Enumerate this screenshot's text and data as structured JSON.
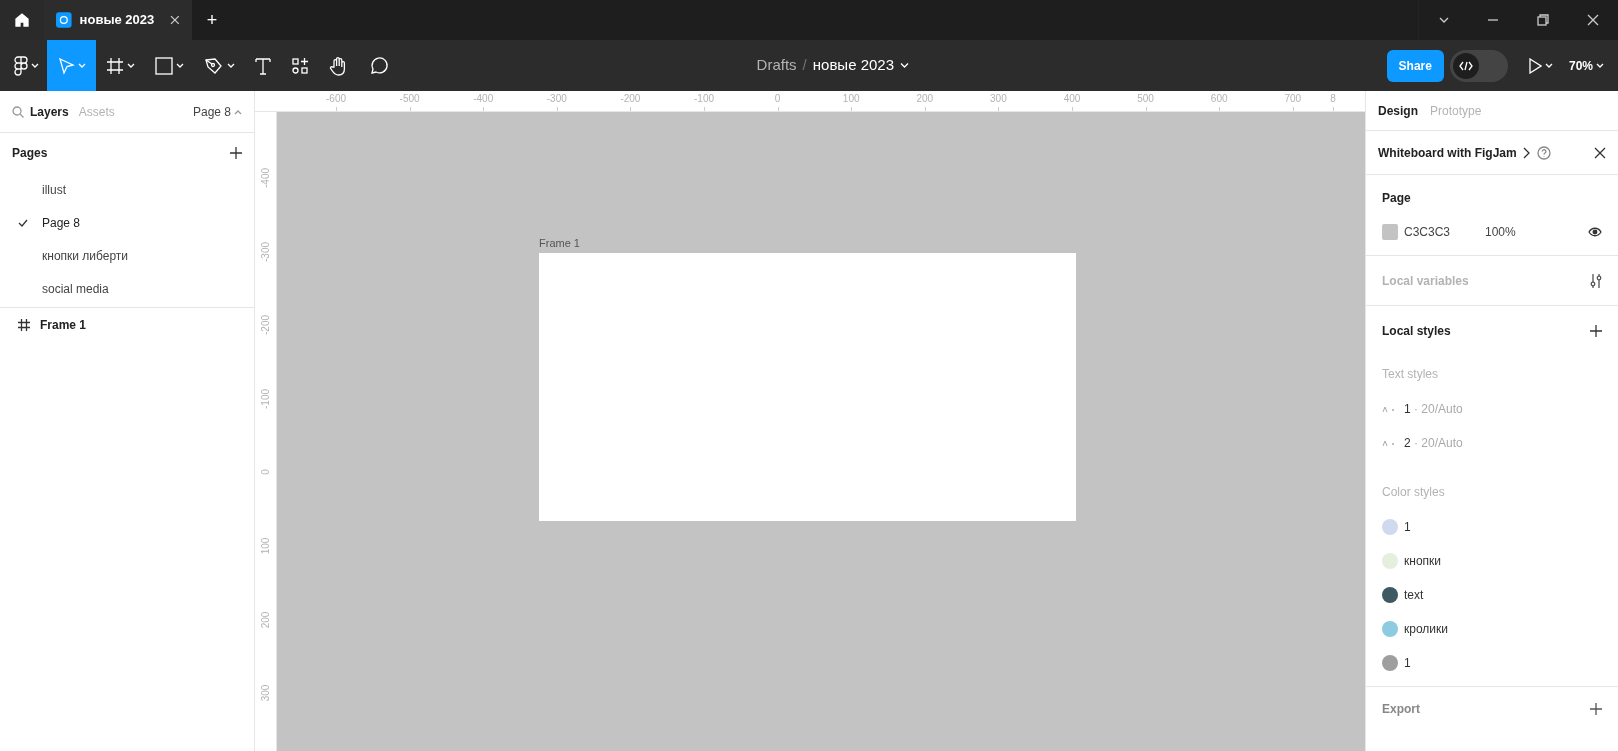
{
  "window_tabs": [
    {
      "kind": "home"
    },
    {
      "kind": "file",
      "title": "новые 2023",
      "selected": true
    },
    {
      "kind": "add",
      "label": "+"
    }
  ],
  "toolbar": {
    "tools": [
      {
        "kind": "main-menu",
        "selected": false,
        "caret": true
      },
      {
        "kind": "move",
        "selected": true,
        "caret": true
      },
      {
        "kind": "frame",
        "selected": false,
        "caret": true
      },
      {
        "kind": "rectangle",
        "selected": false,
        "caret": true
      },
      {
        "kind": "pen",
        "selected": false,
        "caret": true
      },
      {
        "kind": "text",
        "selected": false,
        "caret": false
      },
      {
        "kind": "resources",
        "selected": false,
        "caret": false
      },
      {
        "kind": "hand",
        "selected": false,
        "caret": false
      },
      {
        "kind": "comment",
        "selected": false,
        "caret": false
      }
    ],
    "breadcrumb": {
      "folder": "Drafts",
      "separator": "/",
      "file": "новые 2023"
    },
    "share": "Share",
    "dev_mode": {
      "on": false
    },
    "zoom": "70%"
  },
  "left_panel": {
    "tabs": [
      {
        "label": "Layers",
        "selected": true
      },
      {
        "label": "Assets",
        "selected": false
      }
    ],
    "page_selector": "Page 8",
    "pages_title": "Pages",
    "pages": [
      {
        "name": "illust",
        "selected": false
      },
      {
        "name": "Page 8",
        "selected": true
      },
      {
        "name": "кнопки либерти",
        "selected": false
      },
      {
        "name": "social media",
        "selected": false
      }
    ],
    "layers": [
      {
        "name": "Frame 1"
      }
    ]
  },
  "rulers": {
    "horizontal": [
      "-600",
      "-500",
      "-400",
      "-300",
      "-200",
      "-100",
      "0",
      "100",
      "200",
      "300",
      "400",
      "500",
      "600",
      "700",
      "8"
    ],
    "vertical": [
      "-400",
      "-300",
      "-200",
      "-100",
      "0",
      "100",
      "200",
      "300"
    ]
  },
  "canvas": {
    "frame": {
      "label": "Frame 1"
    }
  },
  "right_panel": {
    "tabs": [
      {
        "label": "Design",
        "selected": true
      },
      {
        "label": "Prototype",
        "selected": false
      }
    ],
    "banner": "Whiteboard with FigJam",
    "page": {
      "title": "Page",
      "color": "#c3c3c3",
      "hex": "C3C3C3",
      "opacity": "100%"
    },
    "local_variables": "Local variables",
    "local_styles": "Local styles",
    "text_styles_title": "Text styles",
    "text_styles": [
      {
        "name": "1",
        "detail": "· 20/Auto"
      },
      {
        "name": "2",
        "detail": "· 20/Auto"
      }
    ],
    "color_styles_title": "Color styles",
    "color_styles": [
      {
        "name": "1",
        "color": "#cfdaee"
      },
      {
        "name": "кнопки",
        "color": "#e6eedd"
      },
      {
        "name": "text",
        "color": "#3e5962"
      },
      {
        "name": "кролики",
        "color": "#8ccbe0"
      },
      {
        "name": "1",
        "color": "#9e9e9e"
      }
    ],
    "export": "Export"
  }
}
